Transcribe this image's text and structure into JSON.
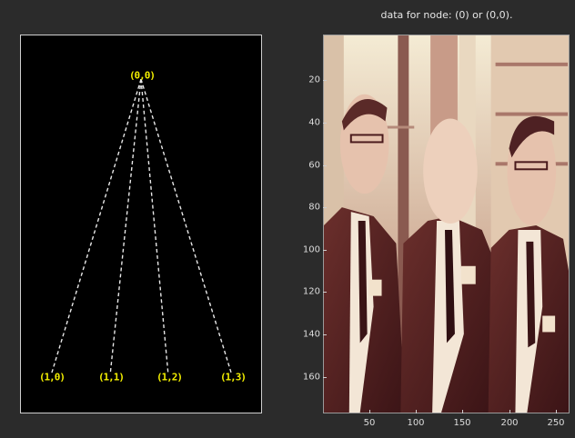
{
  "tree": {
    "root_label": "(0,0)",
    "children": [
      {
        "label": "(1,0)"
      },
      {
        "label": "(1,1)"
      },
      {
        "label": "(1,2)"
      },
      {
        "label": "(1,3)"
      }
    ],
    "colors": {
      "background": "#000000",
      "node": "#f2ee00",
      "edge": "#e8e8e8"
    }
  },
  "image_panel": {
    "title": "data for node: (0) or (0,0).",
    "y_ticks": [
      "20",
      "40",
      "60",
      "80",
      "100",
      "120",
      "140",
      "160"
    ],
    "x_ticks": [
      "50",
      "100",
      "150",
      "200",
      "250"
    ],
    "colormap_colors": [
      "#4a1a1c",
      "#7d3a35",
      "#b9847a",
      "#e6d3b8",
      "#f6eed8"
    ]
  }
}
